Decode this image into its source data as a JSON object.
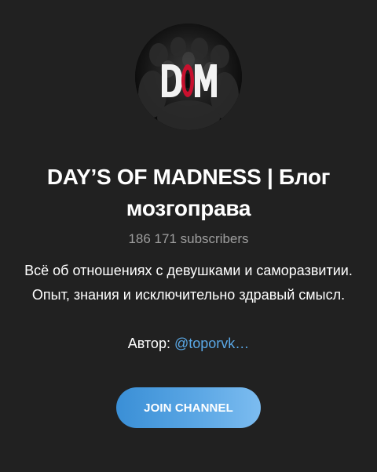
{
  "channel": {
    "title": "DAY’S OF MADNESS | Блог мозгоправа",
    "subscribers": "186 171 subscribers",
    "description_line1": "Всё об отношениях с девушками и саморазвитии. Опыт, знания и исключительно здравый смысл.",
    "author_label": "Автор: ",
    "author_handle": "@toporvk…",
    "avatar_logo_text": "DOM"
  },
  "actions": {
    "join_label": "JOIN CHANNEL"
  },
  "colors": {
    "background": "#212121",
    "text": "#ffffff",
    "muted": "#9e9e9e",
    "link": "#5aa8e6",
    "button_gradient_start": "#3a8fd6",
    "button_gradient_end": "#7cbcf0",
    "logo_accent": "#c8102e"
  }
}
